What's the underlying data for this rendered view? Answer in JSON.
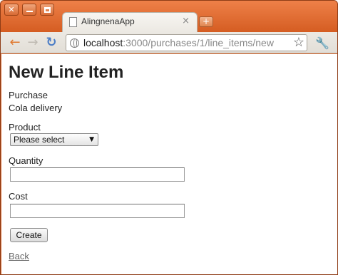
{
  "browser": {
    "tab_title": "AlingnenaApp",
    "tab_close_glyph": "×",
    "new_tab_glyph": "+",
    "back_glyph": "←",
    "forward_glyph": "→",
    "reload_glyph": "↻",
    "url_host": "localhost",
    "url_rest": ":3000/purchases/1/line_items/new",
    "star_glyph": "☆",
    "wrench_glyph": "🔧",
    "window_close_glyph": "✕"
  },
  "page": {
    "heading": "New Line Item",
    "purchase_label": "Purchase",
    "purchase_value": "Cola delivery",
    "product_label": "Product",
    "product_selected": "Please select",
    "product_arrow": "▼",
    "quantity_label": "Quantity",
    "quantity_value": "",
    "cost_label": "Cost",
    "cost_value": "",
    "submit_label": "Create",
    "back_link": "Back"
  },
  "colors": {
    "frame": "#d9682f",
    "link": "#666666"
  }
}
